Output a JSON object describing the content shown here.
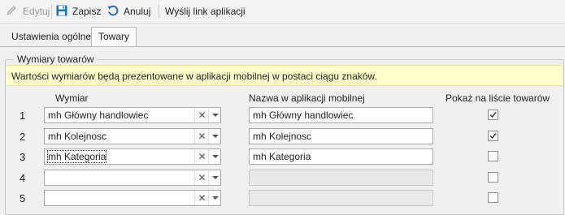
{
  "toolbar": {
    "edit_label": "Edytuj",
    "save_label": "Zapisz",
    "cancel_label": "Anuluj",
    "send_link_label": "Wyślij link aplikacji"
  },
  "tabs": [
    {
      "label": "Ustawienia ogólne",
      "active": false
    },
    {
      "label": "Towary",
      "active": true
    }
  ],
  "group": {
    "title": "Wymiary towarów",
    "info": "Wartości wymiarów będą prezentowane w aplikacji mobilnej w postaci ciągu znaków."
  },
  "columns": {
    "dimension": "Wymiar",
    "mobile_name": "Nazwa w aplikacji mobilnej",
    "show_on_list": "Pokaż na liście towarów"
  },
  "rows": [
    {
      "num": "1",
      "dimension": "mh Główny handlowiec",
      "mobile_name": "mh Główny handlowiec",
      "show": true
    },
    {
      "num": "2",
      "dimension": "mh Kolejnosc",
      "mobile_name": "mh Kolejnosc",
      "show": true
    },
    {
      "num": "3",
      "dimension": "mh Kategoria",
      "mobile_name": "mh Kategoria",
      "show": false
    },
    {
      "num": "4",
      "dimension": "",
      "mobile_name": "",
      "show": false
    },
    {
      "num": "5",
      "dimension": "",
      "mobile_name": "",
      "show": false
    }
  ],
  "icons": {
    "edit": "pencil-icon",
    "save": "floppy-disk-icon",
    "cancel": "undo-arrow-icon",
    "clear": "x-icon",
    "dropdown": "chevron-down-icon",
    "check": "checkmark-icon"
  },
  "colors": {
    "save_icon": "#1d6fc4",
    "cancel_icon": "#2c6fb7",
    "info_background": "#ffffcc"
  }
}
